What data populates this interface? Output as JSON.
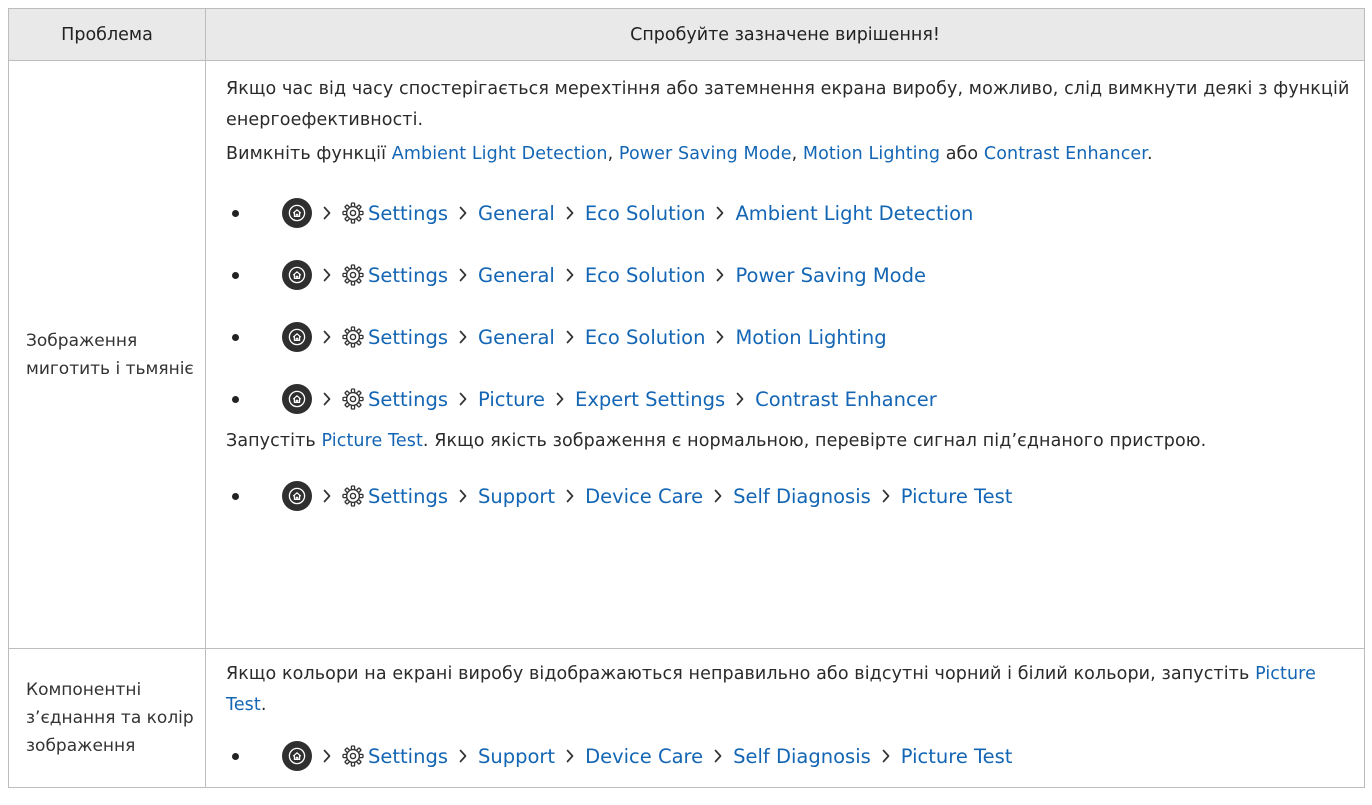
{
  "table": {
    "header": {
      "problem": "Проблема",
      "solution": "Спробуйте зазначене вирішення!"
    },
    "rows": [
      {
        "problem": "Зображення миготить і тьмяніє",
        "p1": "Якщо час від часу спостерігається мерехтіння або затемнення екрана виробу, можливо, слід вимкнути деякі з функцій енергоефективності.",
        "p2": {
          "before": "Вимкніть функції ",
          "opt1": "Ambient Light Detection",
          "sep1": ", ",
          "opt2": "Power Saving Mode",
          "sep2": ", ",
          "opt3": "Motion Lighting",
          "sep3": " або ",
          "opt4": "Contrast Enhancer",
          "after": "."
        },
        "paths": [
          [
            "Settings",
            "General",
            "Eco Solution",
            "Ambient Light Detection"
          ],
          [
            "Settings",
            "General",
            "Eco Solution",
            "Power Saving Mode"
          ],
          [
            "Settings",
            "General",
            "Eco Solution",
            "Motion Lighting"
          ],
          [
            "Settings",
            "Picture",
            "Expert Settings",
            "Contrast Enhancer"
          ]
        ],
        "p3": {
          "before": "Запустіть ",
          "link": "Picture Test",
          "after": ". Якщо якість зображення є нормальною, перевірте сигнал під’єднаного пристрою."
        },
        "paths2": [
          [
            "Settings",
            "Support",
            "Device Care",
            "Self Diagnosis",
            "Picture Test"
          ]
        ]
      },
      {
        "problem": "Компонентні з’єднання та колір зображення",
        "p1": {
          "before": "Якщо кольори на екрані виробу відображаються неправильно або відсутні чорний і білий кольори, запустіть ",
          "link": "Picture Test",
          "after": "."
        },
        "paths": [
          [
            "Settings",
            "Support",
            "Device Care",
            "Self Diagnosis",
            "Picture Test"
          ]
        ]
      }
    ]
  },
  "colors": {
    "accent": "#1466b4",
    "header_bg": "#e9e9e9",
    "border": "#bdbdbd"
  },
  "icons": {
    "home": "home-icon",
    "settings": "gear-icon",
    "separator": "chevron-right-icon"
  }
}
